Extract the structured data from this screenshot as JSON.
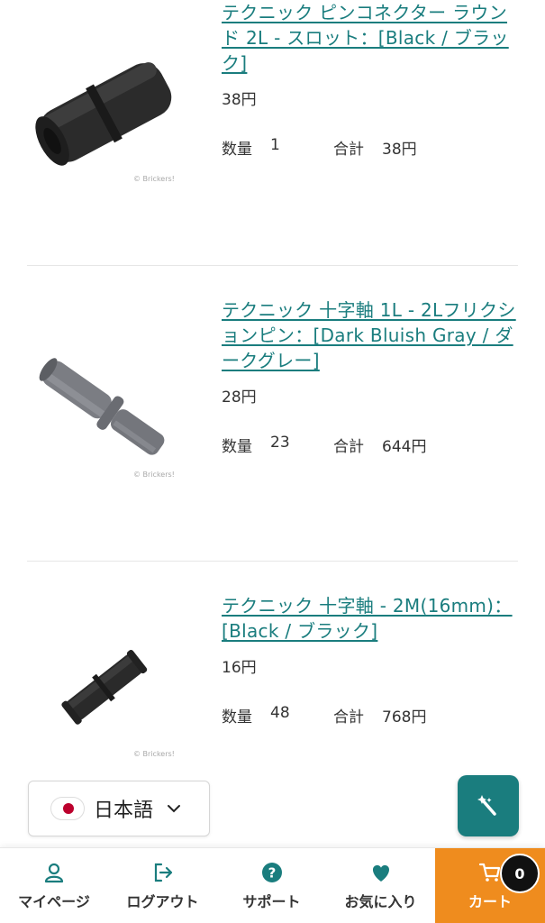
{
  "items": [
    {
      "title": "テクニック ピンコネクター ラウンド 2L - スロット：[Black / ブラック]",
      "price": "38円",
      "qty_label": "数量",
      "qty": "1",
      "total_label": "合計",
      "total": "38円",
      "watermark": "© Brickers!",
      "color": "#2a2a2a"
    },
    {
      "title": "テクニック 十字軸 1L - 2Lフリクションピン：[Dark Bluish Gray / ダークグレー]",
      "price": "28円",
      "qty_label": "数量",
      "qty": "23",
      "total_label": "合計",
      "total": "644円",
      "watermark": "© Brickers!",
      "color": "#6c6e74"
    },
    {
      "title": "テクニック 十字軸 - 2M(16mm)：[Black / ブラック]",
      "price": "16円",
      "qty_label": "数量",
      "qty": "48",
      "total_label": "合計",
      "total": "768円",
      "watermark": "© Brickers!",
      "color": "#2a2a2a"
    }
  ],
  "language": {
    "label": "日本語",
    "icon": "japan-flag-icon"
  },
  "bottom_nav": {
    "mypage": "マイページ",
    "logout": "ログアウト",
    "support": "サポート",
    "favorites": "お気に入り",
    "cart": "カート",
    "cart_count": "0"
  },
  "colors": {
    "accent": "#1a7d7e",
    "cart": "#ef8c1e"
  }
}
